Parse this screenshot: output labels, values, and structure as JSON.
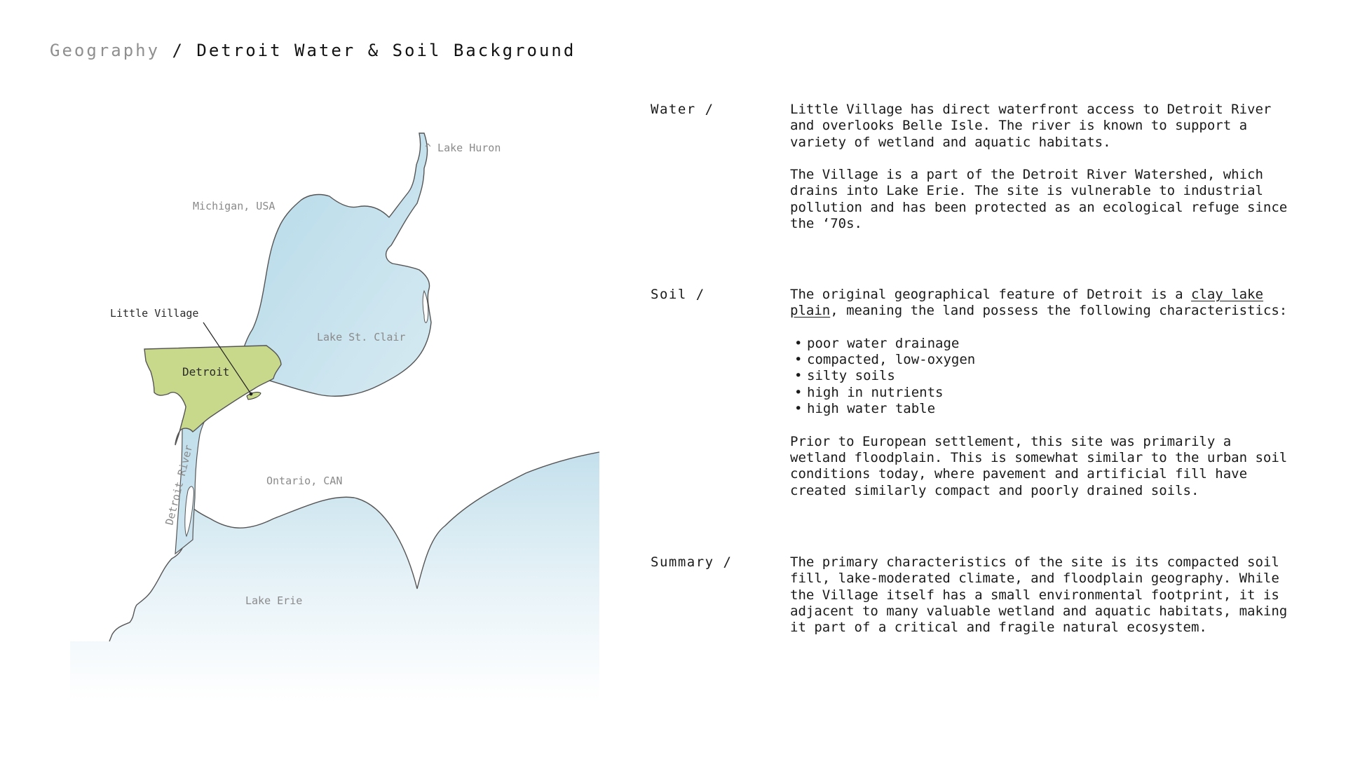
{
  "header": {
    "title_prefix": "Geography",
    "title_separator": " / ",
    "title_main": "Detroit Water & Soil Background"
  },
  "map": {
    "labels": {
      "lake_huron": "^ Lake Huron",
      "michigan": "Michigan, USA",
      "little_village": "Little Village",
      "detroit": "Detroit",
      "lake_st_clair": "Lake St. Clair",
      "detroit_river": "Detroit River",
      "ontario": "Ontario, CAN",
      "lake_erie": "Lake Erie"
    },
    "colors": {
      "water": "#bcdcea",
      "detroit_land": "#c9d98b",
      "outline": "#555555"
    }
  },
  "sections": {
    "water": {
      "label": "Water /",
      "paragraphs": [
        "Little Village has direct waterfront access to Detroit River and overlooks Belle Isle. The river is known to support a variety of wetland and aquatic habitats.",
        "The Village is a part of the Detroit River Watershed, which drains into Lake Erie. The site is vulnerable to industrial pollution and has been protected as an ecological refuge since the ‘70s."
      ]
    },
    "soil": {
      "label": "Soil /",
      "intro_before": "The original geographical feature of Detroit is a ",
      "intro_link": "clay lake plain",
      "intro_after": ", meaning the land possess the following characteristics:",
      "bullets": [
        "poor water drainage",
        "compacted, low-oxygen",
        "silty soils",
        "high in nutrients",
        "high water table"
      ],
      "closing": "Prior to European settlement, this site was primarily a wetland floodplain. This is somewhat similar to the urban soil conditions today, where pavement and artificial fill have created similarly compact and poorly drained soils."
    },
    "summary": {
      "label": "Summary /",
      "paragraph": "The primary characteristics of the site is its compacted soil fill, lake-moderated climate, and floodplain geography. While the Village itself has a small environmental footprint, it is adjacent to many valuable wetland and aquatic habitats, making it part of a critical and fragile natural ecosystem."
    }
  }
}
